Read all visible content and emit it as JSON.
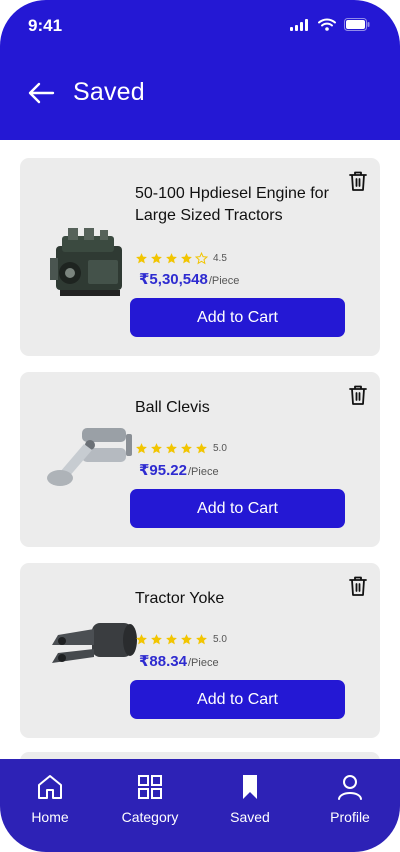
{
  "status_bar": {
    "time": "9:41"
  },
  "header": {
    "title": "Saved"
  },
  "products": [
    {
      "name": "50-100 Hpdiesel Engine for Large Sized Tractors",
      "rating": 4.5,
      "rating_label": "4.5",
      "price": "₹5,30,548",
      "unit": "/Piece",
      "cart_label": "Add to Cart",
      "image_icon": "diesel-engine"
    },
    {
      "name": "Ball Clevis",
      "rating": 5.0,
      "rating_label": "5.0",
      "price": "₹95.22",
      "unit": "/Piece",
      "cart_label": "Add to Cart",
      "image_icon": "ball-clevis"
    },
    {
      "name": "Tractor Yoke",
      "rating": 5.0,
      "rating_label": "5.0",
      "price": "₹88.34",
      "unit": "/Piece",
      "cart_label": "Add to Cart",
      "image_icon": "tractor-yoke"
    }
  ],
  "bottom_nav": {
    "items": [
      {
        "label": "Home",
        "icon": "home-icon"
      },
      {
        "label": "Category",
        "icon": "grid-icon"
      },
      {
        "label": "Saved",
        "icon": "bookmark-icon",
        "active": true
      },
      {
        "label": "Profile",
        "icon": "user-icon"
      }
    ]
  },
  "colors": {
    "primary": "#2418d4",
    "nav": "#2d22b6",
    "card": "#ececec",
    "price": "#2e2bd0",
    "star": "#f2c500"
  }
}
